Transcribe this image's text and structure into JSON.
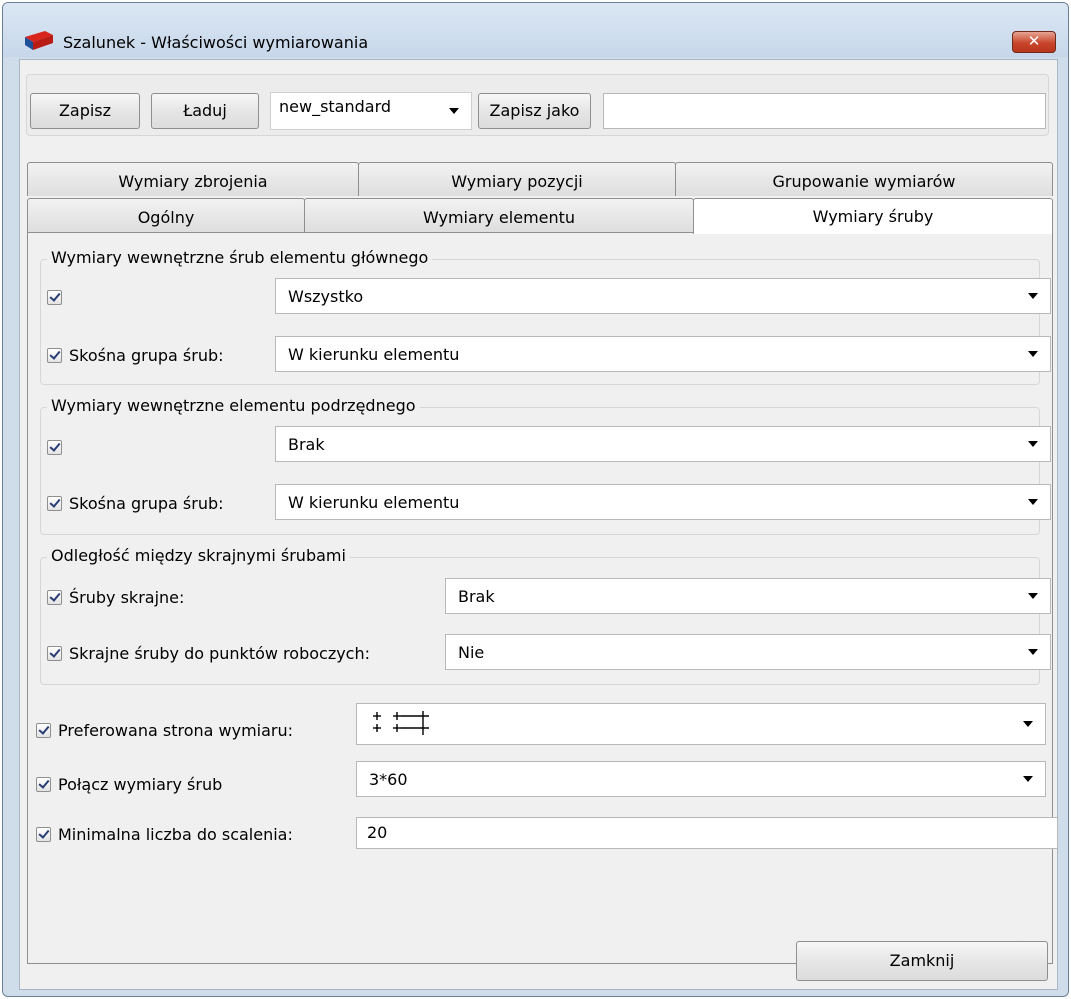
{
  "window": {
    "title": "Szalunek - Właściwości wymiarowania",
    "close_glyph": "✕"
  },
  "toolbar": {
    "save_label": "Zapisz",
    "load_label": "Ładuj",
    "preset_value": "new_standard",
    "save_as_label": "Zapisz jako",
    "save_as_name": ""
  },
  "tabs": {
    "row_top": [
      "Wymiary zbrojenia",
      "Wymiary pozycji",
      "Grupowanie wymiarów"
    ],
    "row_bottom": [
      "Ogólny",
      "Wymiary elementu",
      "Wymiary śruby"
    ],
    "active": "Wymiary śruby"
  },
  "main_inner": {
    "title": "Wymiary wewnętrzne śrub elementu głównego",
    "row1_checked": true,
    "row1_value": "Wszystko",
    "row2_checked": true,
    "row2_label": "Skośna grupa śrub:",
    "row2_value": "W kierunku elementu"
  },
  "sub_inner": {
    "title": "Wymiary wewnętrzne elementu podrzędnego",
    "row1_checked": true,
    "row1_value": "Brak",
    "row2_checked": true,
    "row2_label": "Skośna grupa śrub:",
    "row2_value": "W kierunku elementu"
  },
  "edge_bolts": {
    "title": "Odległość między skrajnymi śrubami",
    "row1_label": "Śruby skrajne:",
    "row1_value": "Brak",
    "row2_label": "Skrajne śruby do punktów roboczych:",
    "row2_value": "Nie"
  },
  "options": {
    "preferred_side_label": "Preferowana strona wymiaru:",
    "preferred_side_icon": "bolt-dimension-side-icon",
    "combine_label": "Połącz wymiary śrub",
    "combine_value": "3*60",
    "min_merge_label": "Minimalna liczba do scalenia:",
    "min_merge_value": "20"
  },
  "footer": {
    "close_label": "Zamknij"
  },
  "colors": {
    "title_bar": "#cfdcea",
    "close_button": "#c8452b",
    "dialog_bg": "#f0f0f0",
    "check_mark": "#283c74"
  }
}
